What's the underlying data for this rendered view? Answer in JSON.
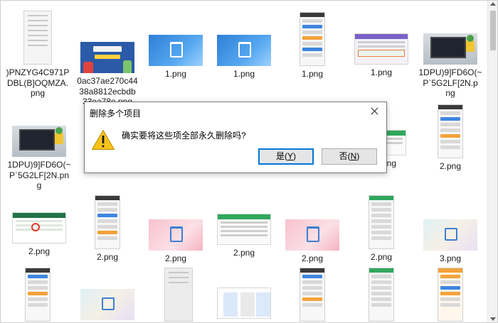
{
  "files": [
    {
      "name": ")PNZYG4C971P\nDBL(B]OQMZA.\npng",
      "thumb": "doc"
    },
    {
      "name": "0ac37ae270c44\n38a8812ecbdb\n33ea78e.png",
      "thumb": "banner",
      "banner_text": "手机掉了 微信聊天记录 怎么恢复？"
    },
    {
      "name": "1.png",
      "thumb": "blue"
    },
    {
      "name": "1.png",
      "thumb": "blue"
    },
    {
      "name": "1.png",
      "thumb": "phone"
    },
    {
      "name": "1.png",
      "thumb": "phone-ui"
    },
    {
      "name": "1DPU)9]FD6O(~\nP`5G2LF[2N.p\nng",
      "thumb": "laptop"
    },
    {
      "name": "1DPU)9]FD6O(~\nP`5G2LF[2N.pn\ng",
      "thumb": "laptop"
    },
    {
      "name": "png",
      "thumb": "ui"
    },
    {
      "name": "2.png",
      "thumb": "phone"
    },
    {
      "name": "2.png",
      "thumb": "excel"
    },
    {
      "name": "2.png",
      "thumb": "phone"
    },
    {
      "name": "2.png",
      "thumb": "pink"
    },
    {
      "name": "2.png",
      "thumb": "ui"
    },
    {
      "name": "2.png",
      "thumb": "pink"
    },
    {
      "name": "2.png",
      "thumb": "phone"
    },
    {
      "name": "3.png",
      "thumb": "pale"
    }
  ],
  "dialog": {
    "title": "删除多个项目",
    "message": "确实要将这些项全部永久删除吗?",
    "yes_label": "是(",
    "yes_key": "Y",
    "yes_tail": ")",
    "no_label": "否(",
    "no_key": "N",
    "no_tail": ")",
    "icon": "warning-icon",
    "accent": "#0078d7"
  }
}
